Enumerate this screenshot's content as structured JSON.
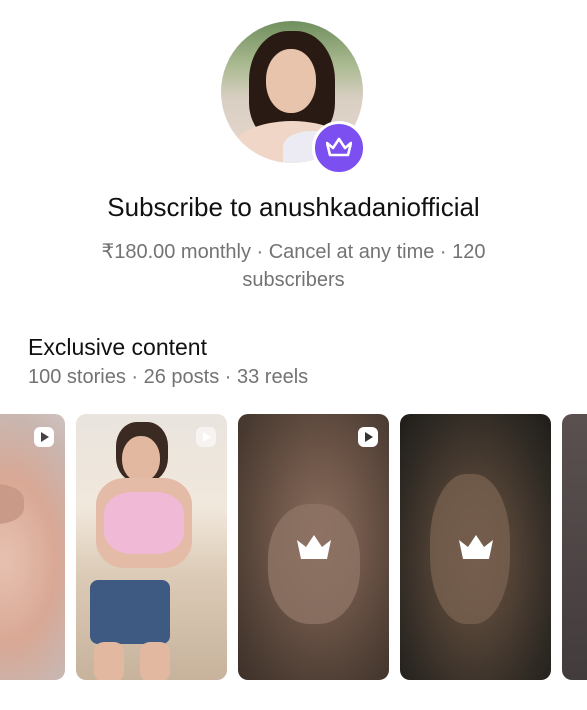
{
  "profile": {
    "avatar_icon": "profile-photo",
    "badge_icon": "crown-icon",
    "badge_color": "#7b4ff0"
  },
  "title": "Subscribe to anushkadaniofficial",
  "subtitle": "₹180.00 monthly · Cancel at any time · 120 subscribers",
  "section": {
    "title": "Exclusive content",
    "stats": "100 stories · 26 posts · 33 reels"
  },
  "thumbnails": [
    {
      "type": "reel",
      "locked": false
    },
    {
      "type": "reel",
      "locked": false
    },
    {
      "type": "reel",
      "locked": true
    },
    {
      "type": "post",
      "locked": true
    },
    {
      "type": "post",
      "locked": true
    }
  ]
}
